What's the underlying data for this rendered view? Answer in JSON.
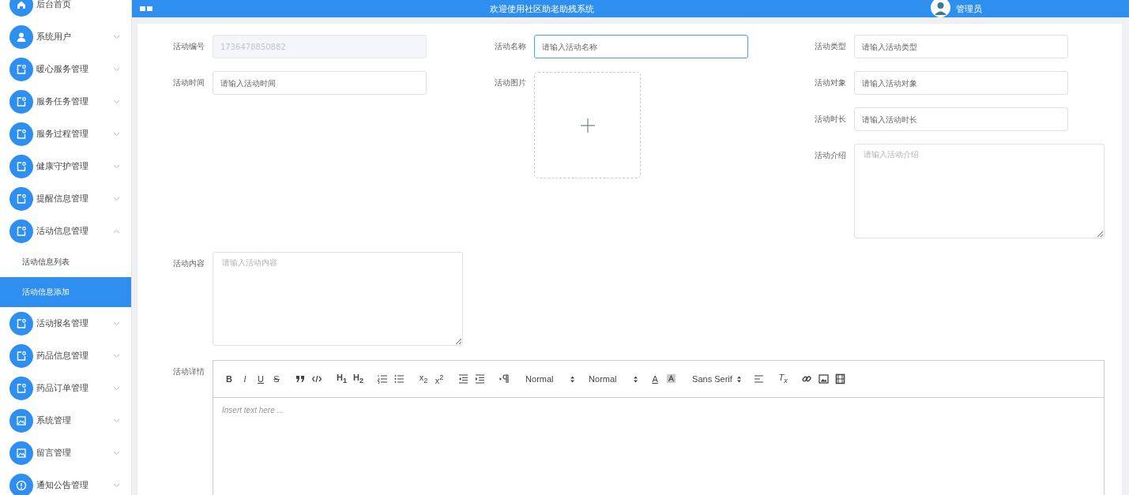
{
  "header": {
    "title": "欢迎使用社区助老助残系统",
    "user": "管理员"
  },
  "sidebar": {
    "items": [
      {
        "label": "后台首页"
      },
      {
        "label": "系统用户",
        "expanded": false
      },
      {
        "label": "暖心服务管理",
        "expanded": false
      },
      {
        "label": "服务任务管理",
        "expanded": false
      },
      {
        "label": "服务过程管理",
        "expanded": false
      },
      {
        "label": "健康守护管理",
        "expanded": false
      },
      {
        "label": "提醒信息管理",
        "expanded": false
      },
      {
        "label": "活动信息管理",
        "expanded": true,
        "children": [
          {
            "label": "活动信息列表",
            "selected": false
          },
          {
            "label": "活动信息添加",
            "selected": true
          }
        ]
      },
      {
        "label": "活动报名管理",
        "expanded": false
      },
      {
        "label": "药品信息管理",
        "expanded": false
      },
      {
        "label": "药品订单管理",
        "expanded": false
      },
      {
        "label": "系统管理",
        "expanded": false
      },
      {
        "label": "留言管理",
        "expanded": false
      },
      {
        "label": "通知公告管理",
        "expanded": false
      }
    ]
  },
  "form": {
    "columns": [
      [
        {
          "label": "活动编号",
          "kind": "input",
          "value": "1736478850882",
          "disabled": true,
          "focused": false
        },
        {
          "label": "活动时间",
          "kind": "input",
          "placeholder": "请输入活动时间",
          "disabled": false,
          "focused": false
        }
      ],
      [
        {
          "label": "活动名称",
          "kind": "input",
          "placeholder": "请输入活动名称",
          "disabled": false,
          "focused": true
        },
        {
          "label": "活动图片",
          "kind": "upload"
        }
      ],
      [
        {
          "label": "活动类型",
          "kind": "input",
          "placeholder": "请输入活动类型",
          "disabled": false,
          "focused": false
        },
        {
          "label": "活动对象",
          "kind": "input",
          "placeholder": "请输入活动对象",
          "disabled": false,
          "focused": false
        },
        {
          "label": "活动时长",
          "kind": "input",
          "placeholder": "请输入活动时长",
          "disabled": false,
          "focused": false
        },
        {
          "label": "活动介绍",
          "kind": "textarea",
          "placeholder": "请输入活动介绍"
        }
      ]
    ],
    "content": {
      "label": "活动内容",
      "kind": "textarea",
      "placeholder": "请输入活动内容"
    },
    "editor": {
      "label": "活动详情",
      "buttons": [
        "B",
        "I",
        "U",
        "S",
        "H$_{1}$",
        "H$_{2}$",
        "x$_{2}$",
        "x$^{2}$",
        "A",
        "T$_{x}$"
      ],
      "selects": [
        "Normal",
        "Normal",
        "Sans Serif"
      ],
      "placeholder": "Insert text here ..."
    }
  }
}
